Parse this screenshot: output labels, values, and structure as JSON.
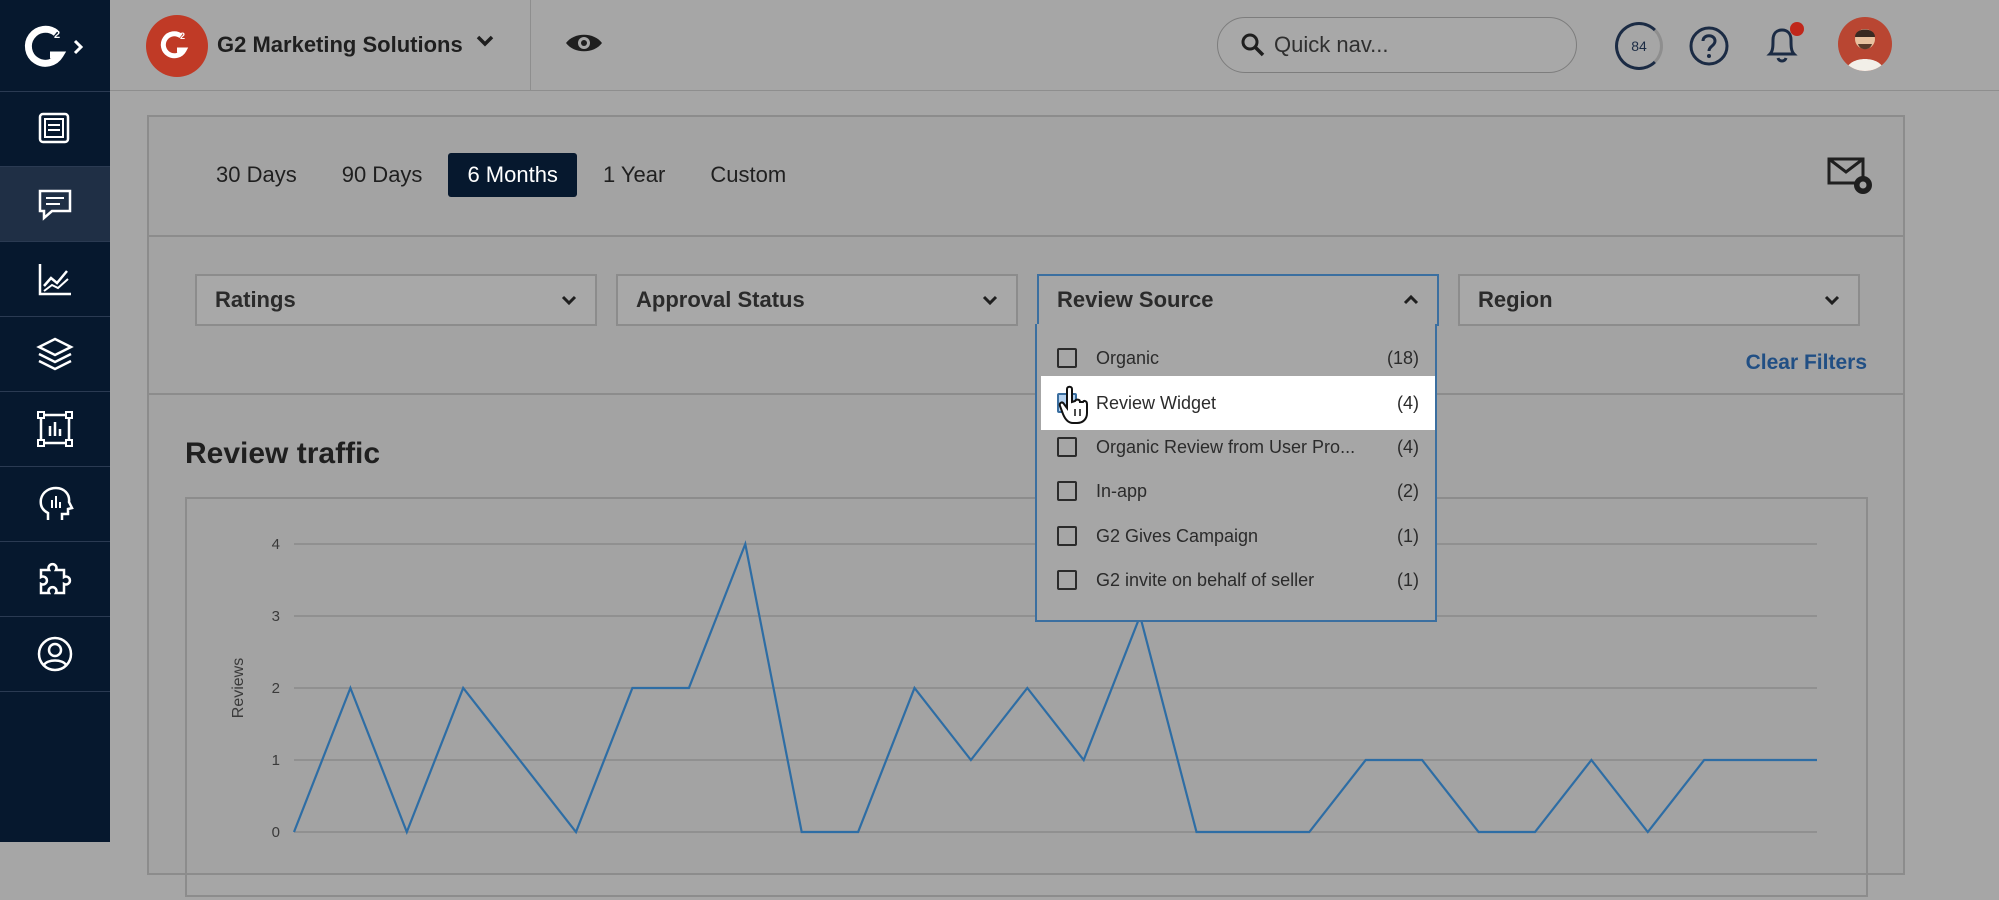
{
  "company": {
    "name": "G2 Marketing Solutions"
  },
  "search": {
    "placeholder": "Quick nav..."
  },
  "score": "84",
  "date_tabs": [
    "30 Days",
    "90 Days",
    "6 Months",
    "1 Year",
    "Custom"
  ],
  "active_tab": "6 Months",
  "filters": {
    "ratings": "Ratings",
    "approval": "Approval Status",
    "source": "Review Source",
    "region": "Region"
  },
  "clear_filters": "Clear Filters",
  "review_source_options": [
    {
      "label": "Organic",
      "count": "(18)"
    },
    {
      "label": "Review Widget",
      "count": "(4)"
    },
    {
      "label": "Organic Review from User Pro...",
      "count": "(4)"
    },
    {
      "label": "In-app",
      "count": "(2)"
    },
    {
      "label": "G2 Gives Campaign",
      "count": "(1)"
    },
    {
      "label": "G2 invite on behalf of seller",
      "count": "(1)"
    }
  ],
  "chart_title": "Review traffic",
  "chart_data": {
    "type": "line",
    "title": "Review traffic",
    "xlabel": "",
    "ylabel": "Reviews",
    "ylim": [
      0,
      4
    ],
    "y_ticks": [
      "0",
      "1",
      "2",
      "3",
      "4"
    ],
    "grid": true,
    "series": [
      {
        "values": [
          0,
          2,
          0,
          2,
          1,
          0,
          2,
          2,
          4,
          0,
          0,
          2,
          1,
          2,
          1,
          3,
          0,
          0,
          0,
          1,
          1,
          0,
          0,
          1,
          0,
          1,
          1,
          1
        ]
      }
    ],
    "color": "#2e6da4"
  }
}
